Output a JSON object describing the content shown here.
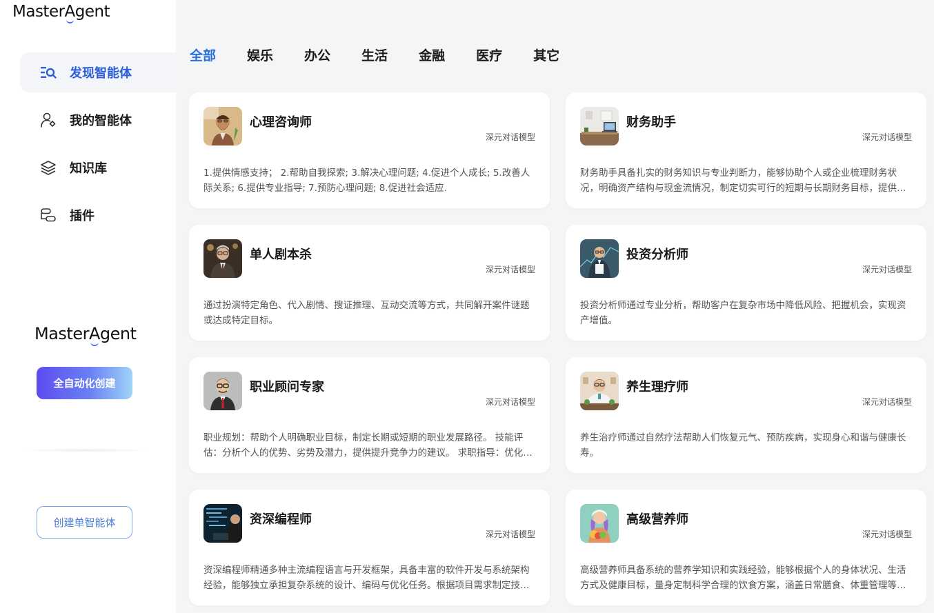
{
  "brand": {
    "logo_text": "Master",
    "logo_a": "A",
    "logo_rest": "gent"
  },
  "sidebar": {
    "items": [
      {
        "label": "发现智能体",
        "icon": "discover-search-icon",
        "active": true
      },
      {
        "label": "我的智能体",
        "icon": "user-agent-icon",
        "active": false
      },
      {
        "label": "知识库",
        "icon": "layers-icon",
        "active": false
      },
      {
        "label": "插件",
        "icon": "plugin-icon",
        "active": false
      }
    ],
    "auto_create_label": "全自动化创建",
    "single_create_label": "创建单智能体"
  },
  "tabs": [
    {
      "label": "全部",
      "active": true
    },
    {
      "label": "娱乐",
      "active": false
    },
    {
      "label": "办公",
      "active": false
    },
    {
      "label": "生活",
      "active": false
    },
    {
      "label": "金融",
      "active": false
    },
    {
      "label": "医疗",
      "active": false
    },
    {
      "label": "其它",
      "active": false
    }
  ],
  "agents": [
    {
      "title": "心理咨询师",
      "tag": "深元对话模型",
      "desc": "1.提供情感支持； 2.帮助自我探索; 3.解决心理问题; 4.促进个人成长; 5.改善人际关系; 6.提供专业指导; 7.预防心理问题; 8.促进社会适应."
    },
    {
      "title": "财务助手",
      "tag": "深元对话模型",
      "desc": "财务助手具备扎实的财务知识与专业判断力，能够协助个人或企业梳理财务状况，明确资产结构与现金流情况，制定切实可行的短期与长期财务目标，提供专业建议。"
    },
    {
      "title": "单人剧本杀",
      "tag": "深元对话模型",
      "desc": "通过扮演特定角色、代入剧情、搜证推理、互动交流等方式，共同解开案件谜题或达成特定目标。"
    },
    {
      "title": "投资分析师",
      "tag": "深元对话模型",
      "desc": "投资分析师通过专业分析，帮助客户在复杂市场中降低风险、把握机会，实现资产增值。"
    },
    {
      "title": "职业顾问专家",
      "tag": "深元对话模型",
      "desc": "职业规划：帮助个人明确职业目标，制定长期或短期的职业发展路径。 技能评估：分析个人的优势、劣势及潜力，提供提升竞争力的建议。 求职指导：优化简历与面试技巧。"
    },
    {
      "title": "养生理疗师",
      "tag": "深元对话模型",
      "desc": "养生治疗师通过自然疗法帮助人们恢复元气、预防疾病，实现身心和谐与健康长寿。"
    },
    {
      "title": "资深编程师",
      "tag": "深元对话模型",
      "desc": "资深编程师精通多种主流编程语言与开发框架，具备丰富的软件开发与系统架构经验，能够独立承担复杂系统的设计、编码与优化任务。根据项目需求制定技术方案。"
    },
    {
      "title": "高级营养师",
      "tag": "深元对话模型",
      "desc": "高级营养师具备系统的营养学知识和实践经验，能够根据个人的身体状况、生活方式及健康目标，量身定制科学合理的饮食方案，涵盖日常膳食、体重管理等方面。"
    }
  ]
}
